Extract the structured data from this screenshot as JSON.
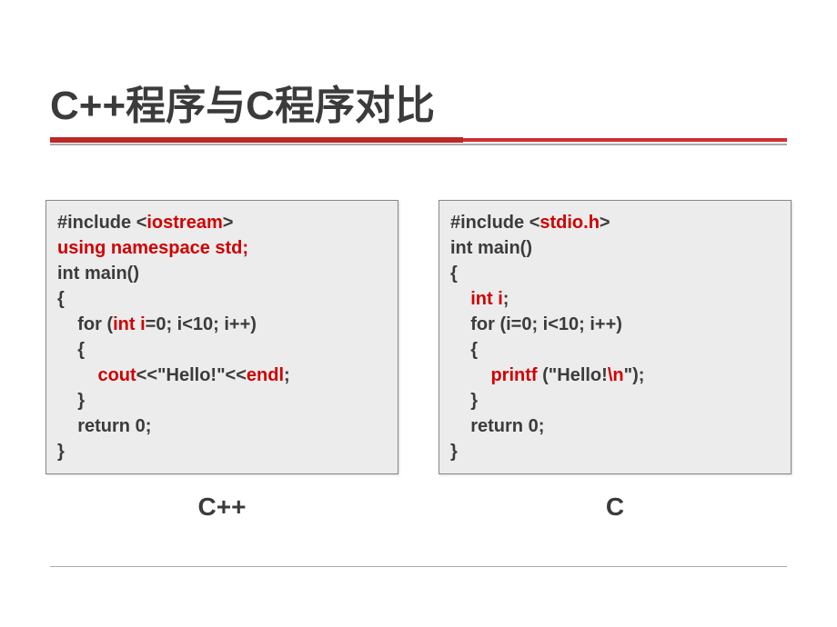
{
  "title": "C++程序与C程序对比",
  "columns": [
    {
      "label": "C++",
      "code_html": "#include &lt;<span class=\"r\">iostream</span>&gt;\n<span class=\"r\">using namespace std;</span>\nint main()\n{\n    for (<span class=\"r\">int i</span>=0; i&lt;10; i++)\n    {\n        <span class=\"r\">cout</span>&lt;&lt;\"Hello!\"&lt;&lt;<span class=\"r\">endl</span>;\n    }\n    return 0;\n}"
    },
    {
      "label": "C",
      "code_html": "#include &lt;<span class=\"r\">stdio.h</span>&gt;\nint main()\n{\n    <span class=\"r\">int i</span>;\n    for (i=0; i&lt;10; i++)\n    {\n        <span class=\"r\">printf</span> (\"Hello!<span class=\"r\">\\n</span>\");\n    }\n    return 0;\n}"
    }
  ]
}
